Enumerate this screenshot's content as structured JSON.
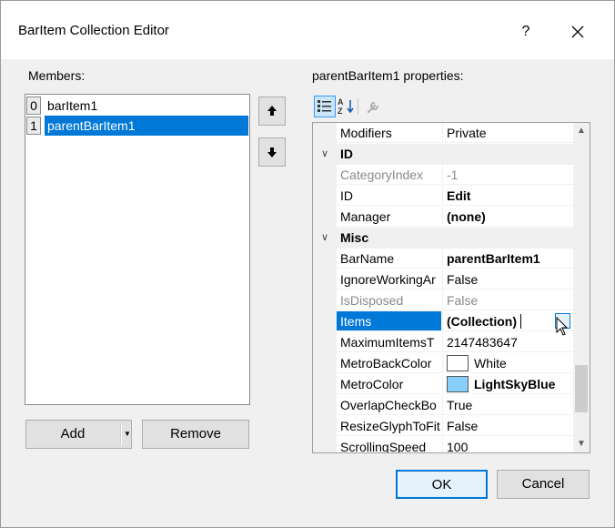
{
  "window": {
    "title": "BarItem Collection Editor",
    "help": "?"
  },
  "members": {
    "label": "Members:",
    "items": [
      {
        "index": "0",
        "name": "barItem1"
      },
      {
        "index": "1",
        "name": "parentBarItem1"
      }
    ],
    "selected_index": 1
  },
  "buttons": {
    "add": "Add",
    "remove": "Remove",
    "ok": "OK",
    "cancel": "Cancel"
  },
  "properties": {
    "label": "parentBarItem1 properties:",
    "rows": [
      {
        "kind": "prop",
        "name": "Modifiers",
        "value": "Private"
      },
      {
        "kind": "cat",
        "name": "ID"
      },
      {
        "kind": "prop",
        "name": "CategoryIndex",
        "value": "-1",
        "muted": true
      },
      {
        "kind": "prop",
        "name": "ID",
        "value": "Edit",
        "bold": true
      },
      {
        "kind": "prop",
        "name": "Manager",
        "value": "(none)",
        "bold": true
      },
      {
        "kind": "cat",
        "name": "Misc"
      },
      {
        "kind": "prop",
        "name": "BarName",
        "value": "parentBarItem1",
        "bold": true
      },
      {
        "kind": "prop",
        "name": "IgnoreWorkingAr",
        "value": "False"
      },
      {
        "kind": "prop",
        "name": "IsDisposed",
        "value": "False",
        "muted": true
      },
      {
        "kind": "prop",
        "name": "Items",
        "value": "(Collection)",
        "bold": true,
        "selected": true
      },
      {
        "kind": "prop",
        "name": "MaximumItemsT",
        "value": "2147483647"
      },
      {
        "kind": "prop",
        "name": "MetroBackColor",
        "value": "White",
        "swatch": "#ffffff"
      },
      {
        "kind": "prop",
        "name": "MetroColor",
        "value": "LightSkyBlue",
        "swatch": "#87cefa",
        "bold": true
      },
      {
        "kind": "prop",
        "name": "OverlapCheckBo",
        "value": "True"
      },
      {
        "kind": "prop",
        "name": "ResizeGlyphToFit",
        "value": "False"
      },
      {
        "kind": "prop",
        "name": "ScrollingSpeed",
        "value": "100"
      }
    ]
  },
  "colors": {
    "accent": "#0078d7",
    "selection": "#0078d7",
    "light_sky_blue": "#87cefa"
  }
}
